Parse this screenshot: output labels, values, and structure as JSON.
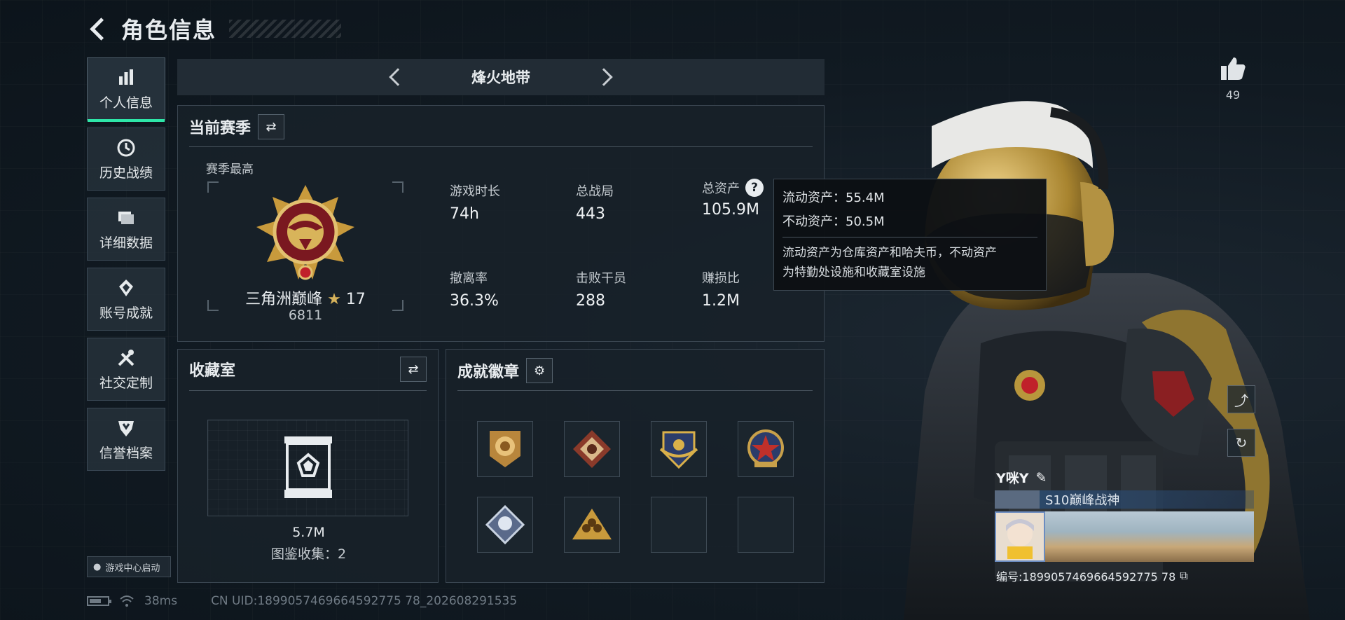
{
  "header": {
    "title": "角色信息"
  },
  "sidebar": {
    "items": [
      {
        "label": "个人信息",
        "icon": "bar-chart-icon",
        "active": true
      },
      {
        "label": "历史战绩",
        "icon": "clock-icon"
      },
      {
        "label": "详细数据",
        "icon": "folder-icon"
      },
      {
        "label": "账号成就",
        "icon": "achievement-icon"
      },
      {
        "label": "社交定制",
        "icon": "tools-icon"
      },
      {
        "label": "信誉档案",
        "icon": "shield-icon"
      }
    ],
    "game_center": "游戏中心启动"
  },
  "status": {
    "ping": "38ms",
    "uid": "CN UID:1899057469664592775 78_202608291535"
  },
  "season_nav": {
    "title": "烽火地带"
  },
  "current_season": {
    "title": "当前赛季",
    "highest_label": "赛季最高",
    "rank_name": "三角洲巅峰",
    "rank_star": "★",
    "rank_level": "17",
    "rank_score": "6811",
    "stats": [
      {
        "label": "游戏时长",
        "value": "74h"
      },
      {
        "label": "总战局",
        "value": "443"
      },
      {
        "label": "总资产",
        "value": "105.9M"
      },
      {
        "label": "撤离率",
        "value": "36.3%"
      },
      {
        "label": "击败干员",
        "value": "288"
      },
      {
        "label": "赚损比",
        "value": "1.2M"
      }
    ]
  },
  "tooltip": {
    "liquid": "流动资产：55.4M",
    "fixed": "不动资产：50.5M",
    "desc_line1": "流动资产为仓库资产和哈夫币，不动资产",
    "desc_line2": "为特勤处设施和收藏室设施"
  },
  "collection": {
    "title": "收藏室",
    "value": "5.7M",
    "count": "图鉴收集：2"
  },
  "badges": {
    "title": "成就徽章"
  },
  "like": {
    "count": "49"
  },
  "card": {
    "name": "Y咪Y",
    "title": "S10巅峰战神",
    "id": "编号:1899057469664592775 78"
  },
  "colors": {
    "accent": "#2ee6a8",
    "gold": "#d6b25b",
    "panel": "#182129"
  }
}
